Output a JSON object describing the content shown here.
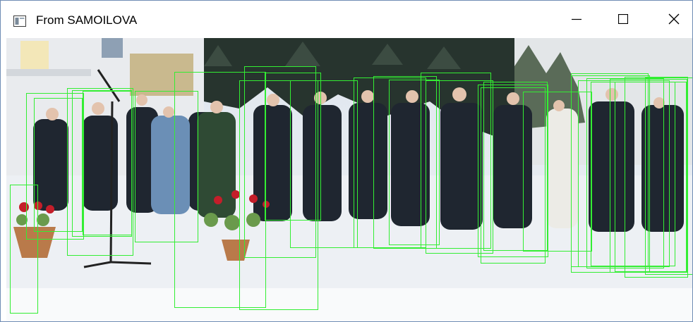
{
  "window": {
    "title": "From SAMOILOVA"
  },
  "icons": {
    "app": "window-app-icon",
    "minimize": "minimize-icon",
    "maximize": "maximize-icon",
    "close": "close-icon"
  },
  "colors": {
    "box": "#33ee33",
    "frame": "#6f8db5"
  },
  "detections": {
    "count": 30
  }
}
